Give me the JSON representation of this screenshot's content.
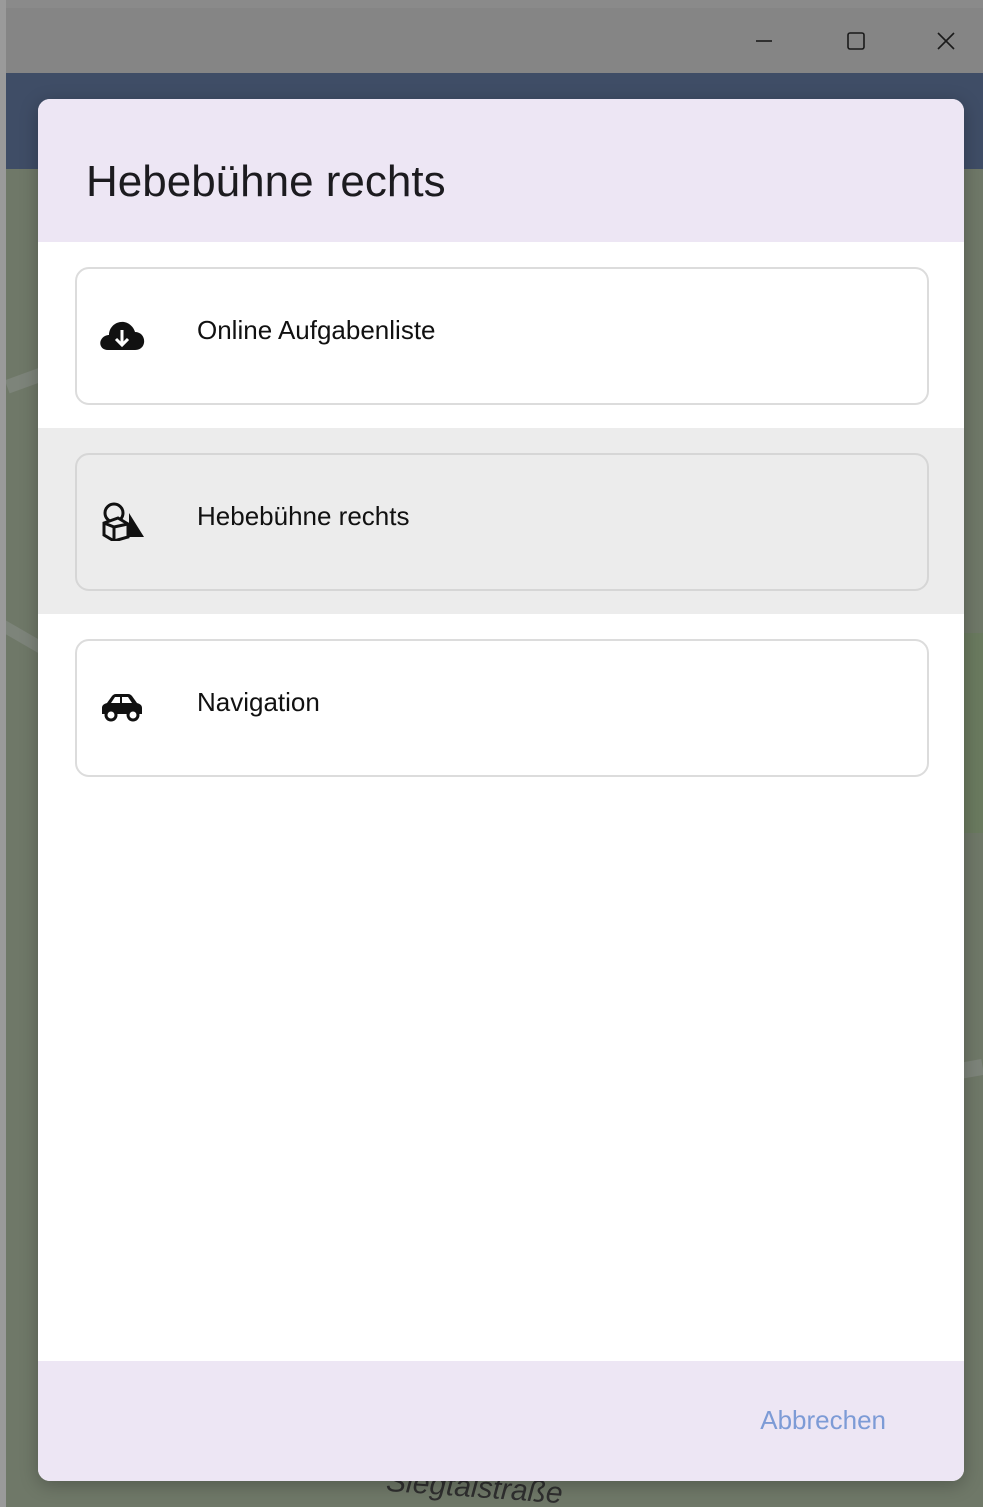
{
  "window": {
    "controls": [
      "minimize-icon",
      "maximize-icon",
      "close-icon"
    ]
  },
  "map": {
    "street_label": "Siegtalstraße"
  },
  "dialog": {
    "title": "Hebebühne rechts",
    "items": [
      {
        "label": "Online Aufgabenliste",
        "icon": "cloud-download-icon",
        "selected": false
      },
      {
        "label": "Hebebühne rechts",
        "icon": "shapes-icon",
        "selected": true
      },
      {
        "label": "Navigation",
        "icon": "car-icon",
        "selected": false
      }
    ],
    "cancel_label": "Abbrechen"
  },
  "colors": {
    "header_bg": "#ede6f4",
    "footer_bg": "#ede6f4",
    "selected_bg": "#ececec",
    "cancel_text": "#7d9bd6",
    "appbar": "#3f4d66"
  }
}
